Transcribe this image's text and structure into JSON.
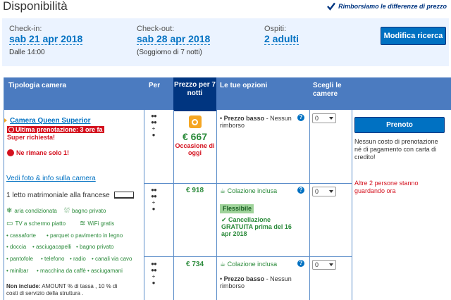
{
  "page": {
    "title": "Disponibilità",
    "price_match": "Rimborsiamo le differenze di prezzo"
  },
  "search": {
    "checkin": {
      "label": "Check-in:",
      "value": "sab 21 apr 2018",
      "sub": "Dalle 14:00"
    },
    "checkout": {
      "label": "Check-out:",
      "value": "sab 28 apr 2018",
      "sub": "(Soggiorno di 7 notti)"
    },
    "guests": {
      "label": "Ospiti:",
      "value": "2 adulti"
    },
    "modify_label": "Modifica ricerca"
  },
  "table": {
    "headers": {
      "room_type": "Tipologia camera",
      "per": "Per",
      "price": "Prezzo per 7 notti",
      "options": "Le tue opzioni",
      "choose": "Scegli le camere"
    },
    "room": {
      "name": "Camera Queen Superior",
      "last_booking_badge": "Ultima prenotazione: 3 ore fa",
      "last_booking_tail": "Super richiesta!",
      "only_one": "Ne rimane solo 1!",
      "photos_link": "Vedi foto & info sulla camera",
      "bed": "1 letto matrimoniale alla francese",
      "facilities": [
        "aria condizionata",
        "bagno privato",
        "TV a schermo piatto",
        "WiFi gratis",
        "• cassaforte",
        "• parquet o pavimento in legno",
        "• doccia",
        "• asciugacapelli",
        "• bagno privato",
        "• pantofole",
        "• telefono",
        "• radio",
        "• canali via cavo",
        "• minibar",
        "• macchina da caffè",
        "• asciugamani"
      ],
      "not_included_label": "Non include:",
      "not_included_text": " AMOUNT % di tassa , 10 % di costi di servizio della struttura ."
    },
    "rows": [
      {
        "price": "€ 667",
        "deal": "Occasione di oggi",
        "option_bold": "Prezzo basso",
        "option_rest": " - Nessun rimborso",
        "qty": "0"
      },
      {
        "price": "€ 918",
        "meal": "Colazione inclusa",
        "flex": "Flessibile",
        "cancel": "Cancellazione GRATUITA prima del 16 apr 2018",
        "qty": "0"
      },
      {
        "price": "€ 734",
        "meal": "Colazione inclusa",
        "option_bold": "Prezzo basso",
        "option_rest": " - Nessun rimborso",
        "qty": "0"
      }
    ],
    "book_label": "Prenoto",
    "no_cost": "Nessun costo di prenotazione né di pagamento con carta di credito!",
    "watching": "Altre 2 persone stanno guardando ora"
  },
  "colors": {
    "accent": "#0071c2",
    "header": "#4b7bc0",
    "header_dark": "#003580",
    "green": "#2a8a3a",
    "red": "#d4111e"
  }
}
